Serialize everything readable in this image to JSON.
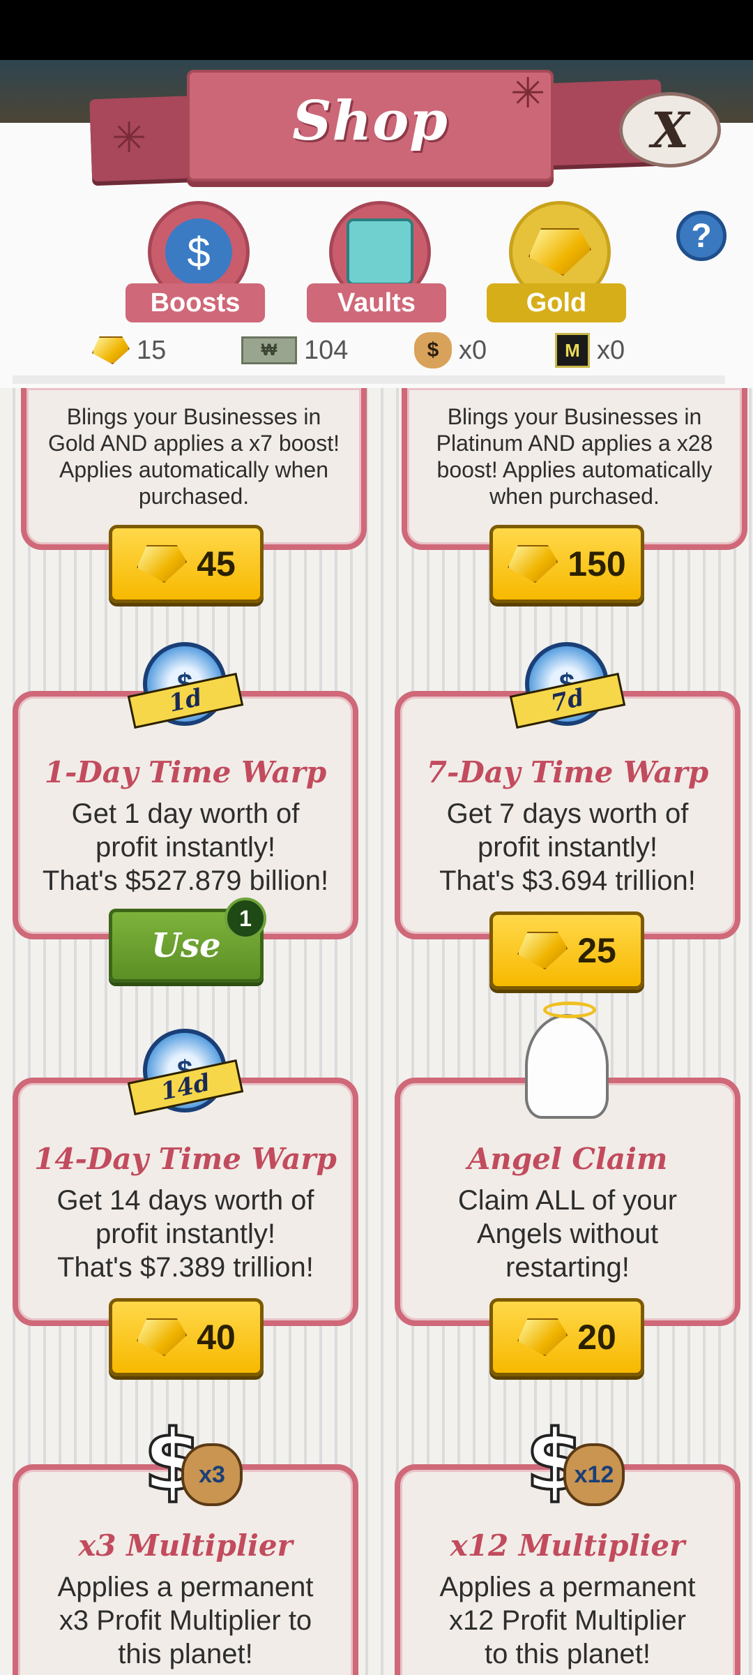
{
  "header": {
    "title": "Shop",
    "close_label": "X",
    "help_label": "?"
  },
  "tabs": [
    {
      "label": "Boosts",
      "icon": "boost-stopwatch-icon",
      "active": false
    },
    {
      "label": "Vaults",
      "icon": "vault-icon",
      "active": false
    },
    {
      "label": "Gold",
      "icon": "gold-gem-icon",
      "active": true
    }
  ],
  "currencies": [
    {
      "icon": "gold-gem-icon",
      "value": "15"
    },
    {
      "icon": "megabucks-bill-icon",
      "value": "104"
    },
    {
      "icon": "money-bag-icon",
      "value": "x0"
    },
    {
      "icon": "megaticket-icon",
      "value": "x0"
    }
  ],
  "items": [
    {
      "id": "gold-blinger",
      "title": "",
      "description": "Blings your Businesses in Gold AND applies a x7 boost! Applies automatically when purchased.",
      "price": "45"
    },
    {
      "id": "platinum-blinger",
      "title": "",
      "description": "Blings your Businesses in Platinum AND applies a x28 boost! Applies automatically when purchased.",
      "price": "150"
    },
    {
      "id": "time-warp-1",
      "title": "1-Day Time Warp",
      "badge": "1d",
      "description_lines": [
        "Get 1 day worth of",
        "profit instantly!",
        "That's $527.879 billion!"
      ],
      "action": "Use",
      "owned_count": "1"
    },
    {
      "id": "time-warp-7",
      "title": "7-Day Time Warp",
      "badge": "7d",
      "description_lines": [
        "Get 7 days worth of",
        "profit instantly!",
        "That's $3.694 trillion!"
      ],
      "price": "25"
    },
    {
      "id": "time-warp-14",
      "title": "14-Day Time Warp",
      "badge": "14d",
      "description_lines": [
        "Get 14 days worth of",
        "profit instantly!",
        "That's $7.389 trillion!"
      ],
      "price": "40"
    },
    {
      "id": "angel-claim",
      "title": "Angel Claim",
      "description_lines": [
        "Claim ALL of your",
        "Angels without",
        "restarting!"
      ],
      "price": "20"
    },
    {
      "id": "multiplier-3",
      "title": "x3 Multiplier",
      "badge": "x3",
      "description_lines": [
        "Applies a permanent",
        "x3 Profit Multiplier to",
        "this planet!"
      ]
    },
    {
      "id": "multiplier-12",
      "title": "x12 Multiplier",
      "badge": "x12",
      "description_lines": [
        "Applies a permanent",
        "x12 Profit Multiplier",
        "to this planet!"
      ]
    }
  ],
  "symbols": {
    "cash_mark": "₩",
    "dollar": "$",
    "mega_mark": "M"
  },
  "colors": {
    "card_border": "#cf6878",
    "title_red": "#c24b5e",
    "gold": "#f7b900",
    "use_green": "#5c8f25"
  }
}
